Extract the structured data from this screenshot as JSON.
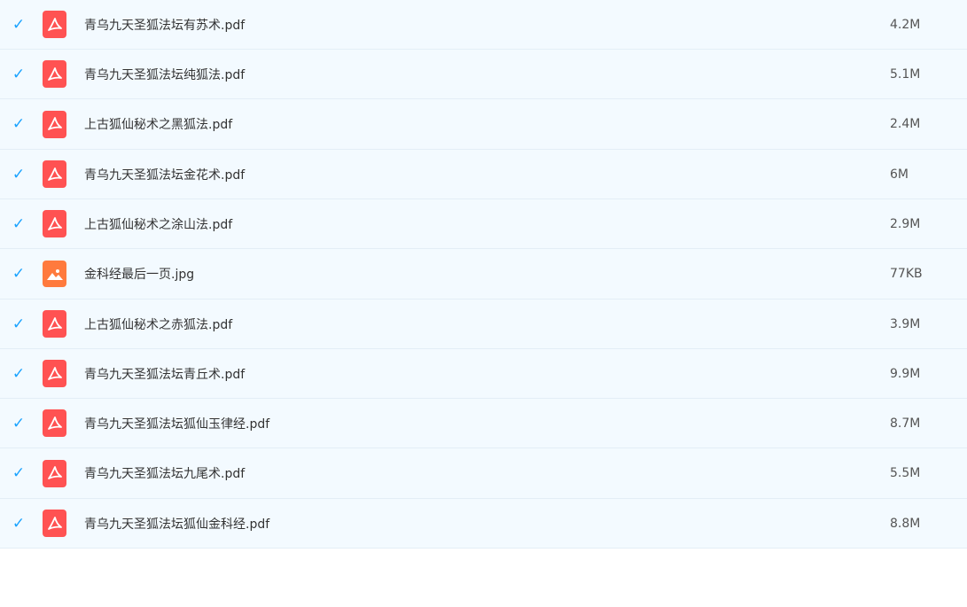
{
  "files": [
    {
      "name": "青乌九天圣狐法坛有苏术.pdf",
      "size": "4.2M",
      "type": "pdf",
      "checked": true
    },
    {
      "name": "青乌九天圣狐法坛纯狐法.pdf",
      "size": "5.1M",
      "type": "pdf",
      "checked": true
    },
    {
      "name": "上古狐仙秘术之黑狐法.pdf",
      "size": "2.4M",
      "type": "pdf",
      "checked": true
    },
    {
      "name": "青乌九天圣狐法坛金花术.pdf",
      "size": "6M",
      "type": "pdf",
      "checked": true
    },
    {
      "name": "上古狐仙秘术之涂山法.pdf",
      "size": "2.9M",
      "type": "pdf",
      "checked": true
    },
    {
      "name": "金科经最后一页.jpg",
      "size": "77KB",
      "type": "image",
      "checked": true
    },
    {
      "name": "上古狐仙秘术之赤狐法.pdf",
      "size": "3.9M",
      "type": "pdf",
      "checked": true
    },
    {
      "name": "青乌九天圣狐法坛青丘术.pdf",
      "size": "9.9M",
      "type": "pdf",
      "checked": true
    },
    {
      "name": "青乌九天圣狐法坛狐仙玉律经.pdf",
      "size": "8.7M",
      "type": "pdf",
      "checked": true
    },
    {
      "name": "青乌九天圣狐法坛九尾术.pdf",
      "size": "5.5M",
      "type": "pdf",
      "checked": true
    },
    {
      "name": "青乌九天圣狐法坛狐仙金科经.pdf",
      "size": "8.8M",
      "type": "pdf",
      "checked": true
    }
  ],
  "colors": {
    "row_background": "#f3faff",
    "checkbox": "#1aa3ff",
    "pdf_icon": "#ff5252",
    "image_icon": "#ff7a3d"
  },
  "icons": {
    "checkbox": "checkmark-icon",
    "pdf": "pdf-icon",
    "image": "image-icon"
  }
}
